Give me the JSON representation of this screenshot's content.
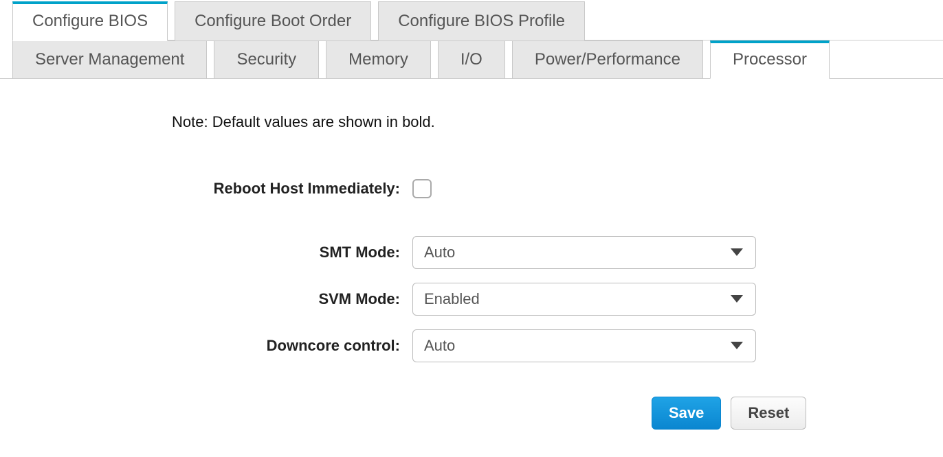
{
  "topTabs": [
    {
      "label": "Configure BIOS",
      "active": true
    },
    {
      "label": "Configure Boot Order",
      "active": false
    },
    {
      "label": "Configure BIOS Profile",
      "active": false
    }
  ],
  "subTabs": [
    {
      "label": "Server Management",
      "active": false
    },
    {
      "label": "Security",
      "active": false
    },
    {
      "label": "Memory",
      "active": false
    },
    {
      "label": "I/O",
      "active": false
    },
    {
      "label": "Power/Performance",
      "active": false
    },
    {
      "label": "Processor",
      "active": true
    }
  ],
  "note": "Note: Default values are shown in bold.",
  "form": {
    "rebootLabel": "Reboot Host Immediately:",
    "rebootChecked": false,
    "smtLabel": "SMT Mode:",
    "smtValue": "Auto",
    "svmLabel": "SVM Mode:",
    "svmValue": "Enabled",
    "downcoreLabel": "Downcore control:",
    "downcoreValue": "Auto"
  },
  "buttons": {
    "save": "Save",
    "reset": "Reset"
  }
}
